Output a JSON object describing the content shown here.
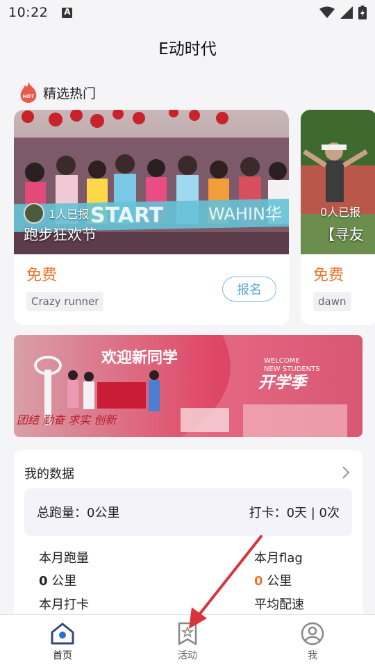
{
  "status_bar": {
    "time": "10:22"
  },
  "header": {
    "title": "E动时代"
  },
  "hot_section": {
    "title": "精选热门"
  },
  "cards": [
    {
      "join_text": "1人已报",
      "title": "跑步狂欢节",
      "banner_text": "START  WAHIN华",
      "price": "免费",
      "tag": "Crazy runner",
      "signup_label": "报名"
    },
    {
      "join_text": "0人已报",
      "title": "【寻友",
      "price": "免费",
      "tag": "dawn"
    }
  ],
  "banner": {
    "title": "欢迎新同学",
    "welcome_line1": "WELCOME",
    "welcome_line2": "NEW STUDENTS",
    "subtitle": "开学季",
    "motto": "团结  勤奋  求实  创新"
  },
  "my_data": {
    "title": "我的数据",
    "total_distance": "总跑量：0公里",
    "checkin": "打卡：0天 | 0次",
    "month_distance_label": "本月跑量",
    "month_distance_value": "0",
    "month_distance_unit": "公里",
    "month_flag_label": "本月flag",
    "month_flag_value": "0",
    "month_flag_unit": "公里",
    "month_checkin_label": "本月打卡",
    "avg_pace_label": "平均配速"
  },
  "bottom_nav": {
    "items": [
      {
        "label": "首页",
        "icon": "home-icon",
        "active": true
      },
      {
        "label": "活动",
        "icon": "activity-icon",
        "active": false
      },
      {
        "label": "我",
        "icon": "profile-icon",
        "active": false
      }
    ]
  },
  "colors": {
    "accent_orange": "#e8772e",
    "signup_blue": "#5fa3db",
    "arrow_red": "#d9343a",
    "nav_blue": "#2f6fd1"
  }
}
